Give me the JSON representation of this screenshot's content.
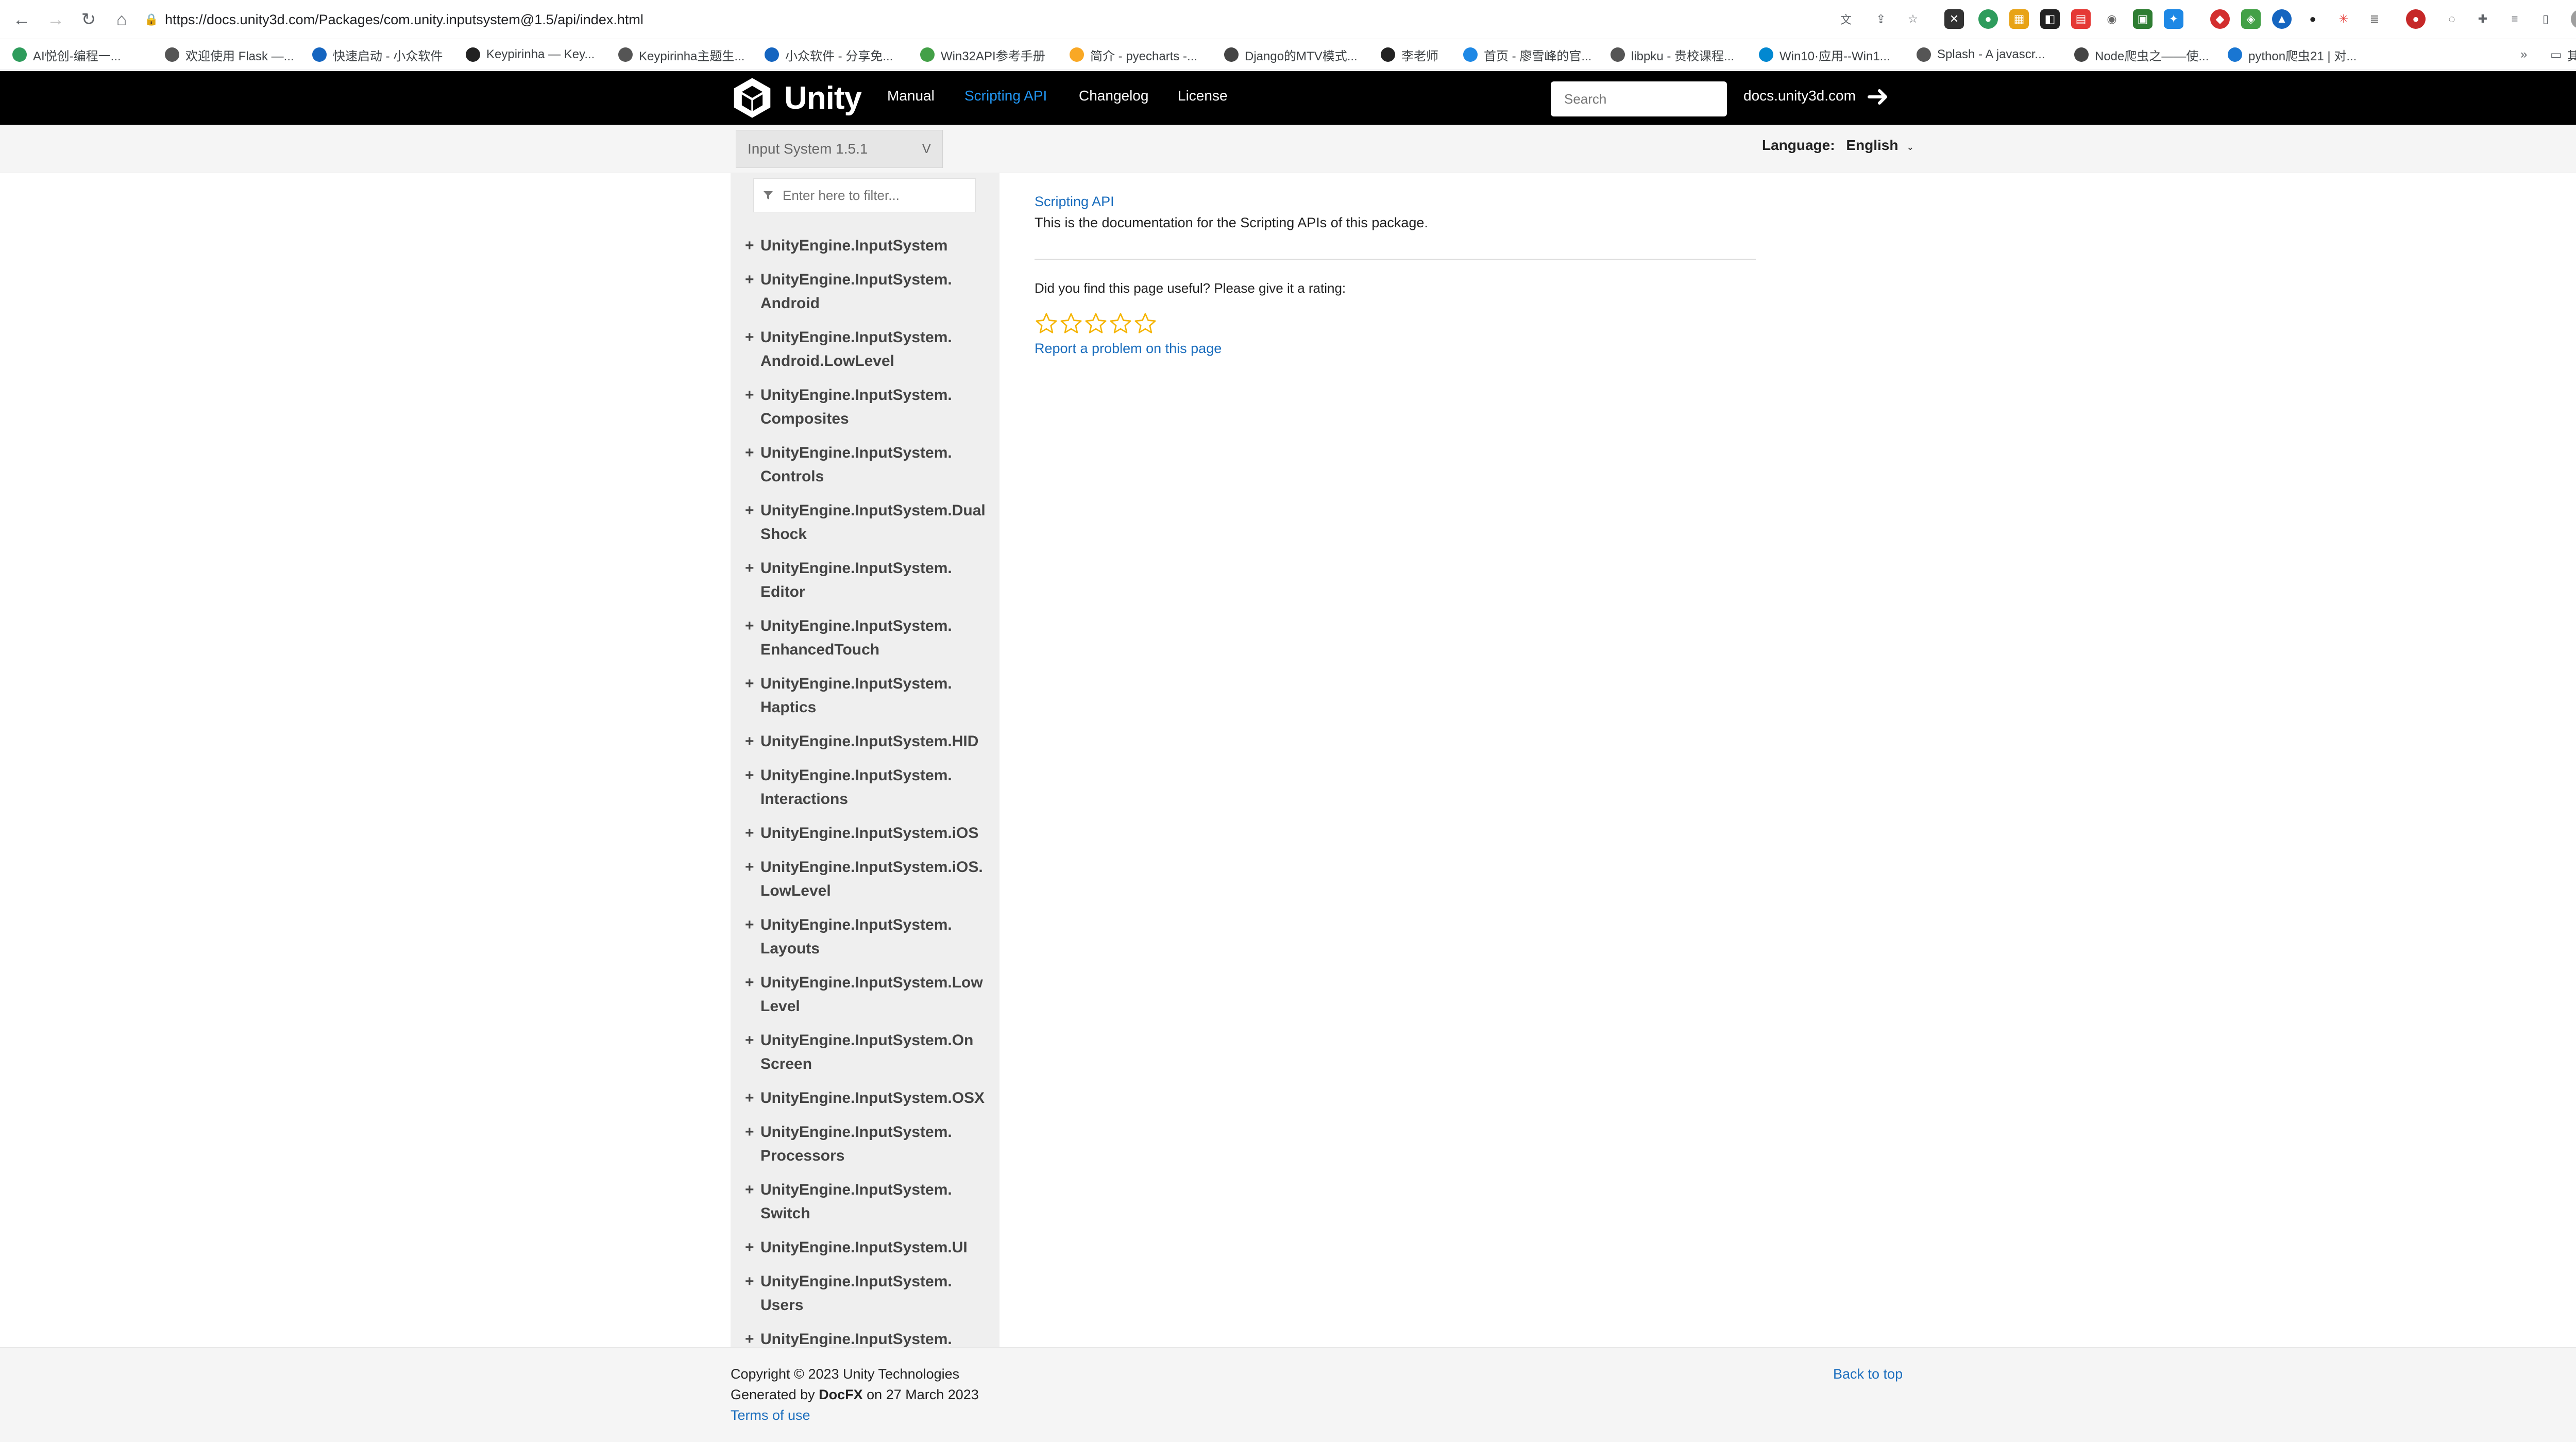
{
  "browser": {
    "url": "https://docs.unity3d.com/Packages/com.unity.inputsystem@1.5/api/index.html",
    "bookmarks": [
      {
        "label": "AI悦创-编程一...",
        "color": "#2e9c5c"
      },
      {
        "label": "欢迎使用 Flask —...",
        "color": "#555555"
      },
      {
        "label": "快速启动 - 小众软件",
        "color": "#1565c0"
      },
      {
        "label": "Keypirinha — Key...",
        "color": "#222222"
      },
      {
        "label": "Keypirinha主题生...",
        "color": "#555555"
      },
      {
        "label": "小众软件 - 分享免...",
        "color": "#1565c0"
      },
      {
        "label": "Win32API参考手册",
        "color": "#43a047"
      },
      {
        "label": "简介 - pyecharts -...",
        "color": "#f9a825"
      },
      {
        "label": "Django的MTV模式...",
        "color": "#444444"
      },
      {
        "label": "李老师",
        "color": "#222222"
      },
      {
        "label": "首页 - 廖雪峰的官...",
        "color": "#1e88e5"
      },
      {
        "label": "libpku - 贵校课程...",
        "color": "#555555"
      },
      {
        "label": "Win10·应用--Win1...",
        "color": "#0288d1"
      },
      {
        "label": "Splash - A javascr...",
        "color": "#555555"
      },
      {
        "label": "Node爬虫之——使...",
        "color": "#444444"
      },
      {
        "label": "python爬虫21 | 对...",
        "color": "#1976d2"
      }
    ],
    "more_bookmarks": "»",
    "other_bookmarks": "其他书签"
  },
  "header": {
    "logo_text": "Unity",
    "nav": {
      "manual": "Manual",
      "scripting_api": "Scripting API",
      "changelog": "Changelog",
      "license": "License"
    },
    "search_placeholder": "Search",
    "site_link": "docs.unity3d.com"
  },
  "subheader": {
    "version": "Input System 1.5.1",
    "version_chevron": "V",
    "language_label": "Language:",
    "language_value": "English"
  },
  "sidebar": {
    "filter_placeholder": "Enter here to filter...",
    "items": [
      "UnityEngine.InputSystem",
      "UnityEngine.InputSystem. Android",
      "UnityEngine.InputSystem. Android.LowLevel",
      "UnityEngine.InputSystem. Composites",
      "UnityEngine.InputSystem. Controls",
      "UnityEngine.InputSystem.Dual Shock",
      "UnityEngine.InputSystem. Editor",
      "UnityEngine.InputSystem. EnhancedTouch",
      "UnityEngine.InputSystem. Haptics",
      "UnityEngine.InputSystem.HID",
      "UnityEngine.InputSystem. Interactions",
      "UnityEngine.InputSystem.iOS",
      "UnityEngine.InputSystem.iOS. LowLevel",
      "UnityEngine.InputSystem. Layouts",
      "UnityEngine.InputSystem.Low Level",
      "UnityEngine.InputSystem.On Screen",
      "UnityEngine.InputSystem.OSX",
      "UnityEngine.InputSystem. Processors",
      "UnityEngine.InputSystem. Switch",
      "UnityEngine.InputSystem.UI",
      "UnityEngine.InputSystem. Users",
      "UnityEngine.InputSystem."
    ]
  },
  "main": {
    "breadcrumb": "Scripting API",
    "intro": "This is the documentation for the Scripting APIs of this package.",
    "rating_prompt": "Did you find this page useful? Please give it a rating:",
    "star_count": 5,
    "report_link": "Report a problem on this page"
  },
  "footer": {
    "copyright": "Copyright © 2023 Unity Technologies",
    "generated_prefix": "Generated by",
    "generator": "DocFX",
    "generated_suffix": "on 27 March 2023",
    "terms": "Terms of use",
    "back_to_top": "Back to top"
  },
  "colors": {
    "link": "#1a6dbd",
    "active_nav": "#2196f3",
    "star": "#f5b400"
  }
}
